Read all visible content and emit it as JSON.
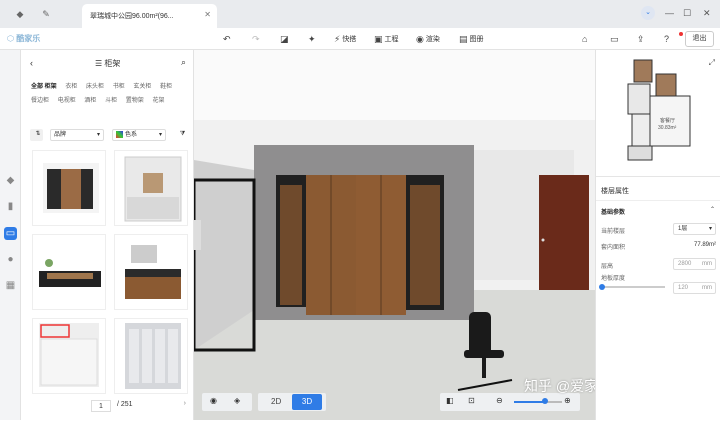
{
  "tab": {
    "title": "翠瑞城中公园96.00m²(96..."
  },
  "toolbar": {
    "logo": "酷家乐",
    "undo": "↶",
    "redo": "↷",
    "erase": "⌫",
    "tools": "🔧",
    "quick": "快搭",
    "engineering": "工程",
    "render": "渲染",
    "drawings": "图册",
    "exit": "退出"
  },
  "panel": {
    "title": "柜架",
    "categories": [
      "全部 柜架",
      "衣柜",
      "床头柜",
      "书柜",
      "玄关柜",
      "鞋柜",
      "餐边柜",
      "电视柜",
      "酒柜",
      "斗柜",
      "置物架",
      "花架"
    ],
    "filter_brand": "品牌",
    "filter_color": "色系",
    "page": "1",
    "total": "/ 251"
  },
  "view": {
    "mode_2d": "2D",
    "mode_3d": "3D"
  },
  "props": {
    "minimap_label": "客餐厅",
    "minimap_area": "30.83m²",
    "title": "楼层属性",
    "section": "基础参数",
    "floor_label": "当前楼层",
    "floor_value": "1层",
    "area_label": "套内面积",
    "area_value": "77.89m²",
    "height_label": "层高",
    "height_value": "2800",
    "height_unit": "mm",
    "slab_label": "地板厚度",
    "slab_value": "120",
    "slab_unit": "mm"
  },
  "watermark": "知乎 @爱家爱设计",
  "colors": {
    "accent": "#2f7ce6",
    "wood": "#8b5a32"
  }
}
